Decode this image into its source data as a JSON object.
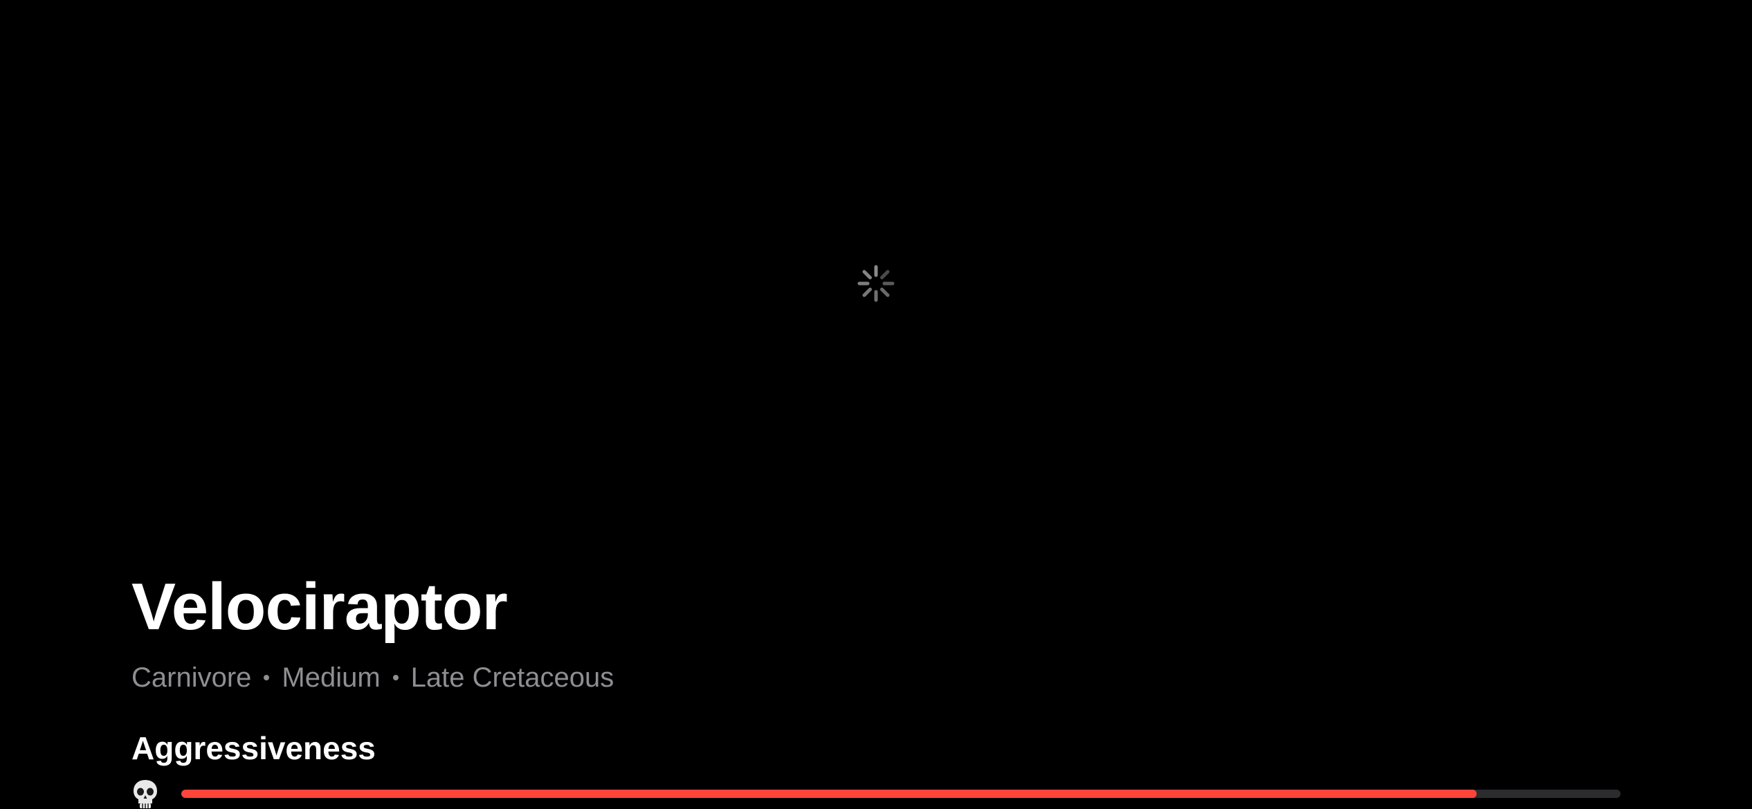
{
  "dinosaur": {
    "name": "Velociraptor",
    "diet": "Carnivore",
    "size": "Medium",
    "period": "Late Cretaceous"
  },
  "media": {
    "loading_icon": "activity-spinner-icon"
  },
  "stats": {
    "aggressiveness": {
      "label": "Aggressiveness",
      "icon": "skull-icon",
      "fraction": 0.9,
      "fill_color": "#ff453a",
      "track_color": "#2c2c2e"
    }
  },
  "colors": {
    "background": "#000000",
    "title": "#ffffff",
    "secondary_text": "#8e8e93"
  }
}
